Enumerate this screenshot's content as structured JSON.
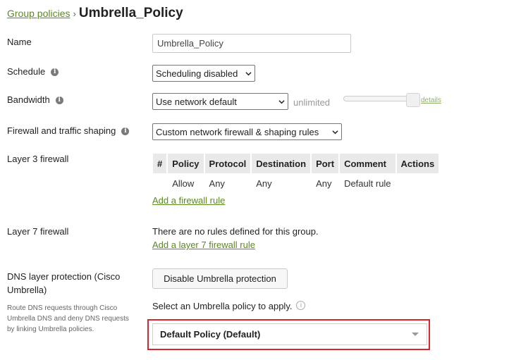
{
  "breadcrumb": {
    "parent": "Group policies",
    "separator": "›",
    "title": "Umbrella_Policy"
  },
  "name": {
    "label": "Name",
    "value": "Umbrella_Policy"
  },
  "schedule": {
    "label": "Schedule",
    "value": "Scheduling disabled"
  },
  "bandwidth": {
    "label": "Bandwidth",
    "value": "Use network default",
    "limit_text": "unlimited",
    "details_link": "details"
  },
  "firewall_shaping": {
    "label": "Firewall and traffic shaping",
    "value": "Custom network firewall & shaping rules"
  },
  "layer3": {
    "label": "Layer 3 firewall",
    "columns": [
      "#",
      "Policy",
      "Protocol",
      "Destination",
      "Port",
      "Comment",
      "Actions"
    ],
    "rows": [
      [
        "",
        "Allow",
        "Any",
        "Any",
        "Any",
        "Default rule",
        ""
      ]
    ],
    "add_link": "Add a firewall rule"
  },
  "layer7": {
    "label": "Layer 7 firewall",
    "empty_text": "There are no rules defined for this group.",
    "add_link": "Add a layer 7 firewall rule"
  },
  "dns": {
    "label": "DNS layer protection (Cisco Umbrella)",
    "help_text": "Route DNS requests through Cisco Umbrella DNS and deny DNS requests by linking Umbrella policies.",
    "button_label": "Disable Umbrella protection",
    "prompt": "Select an Umbrella policy to apply.",
    "policy_value": "Default Policy (Default)"
  },
  "icons": {
    "info": "info-icon",
    "caret": "chevron-down-icon"
  },
  "colors": {
    "link": "#5b8a1f",
    "highlight": "#d9262c"
  }
}
